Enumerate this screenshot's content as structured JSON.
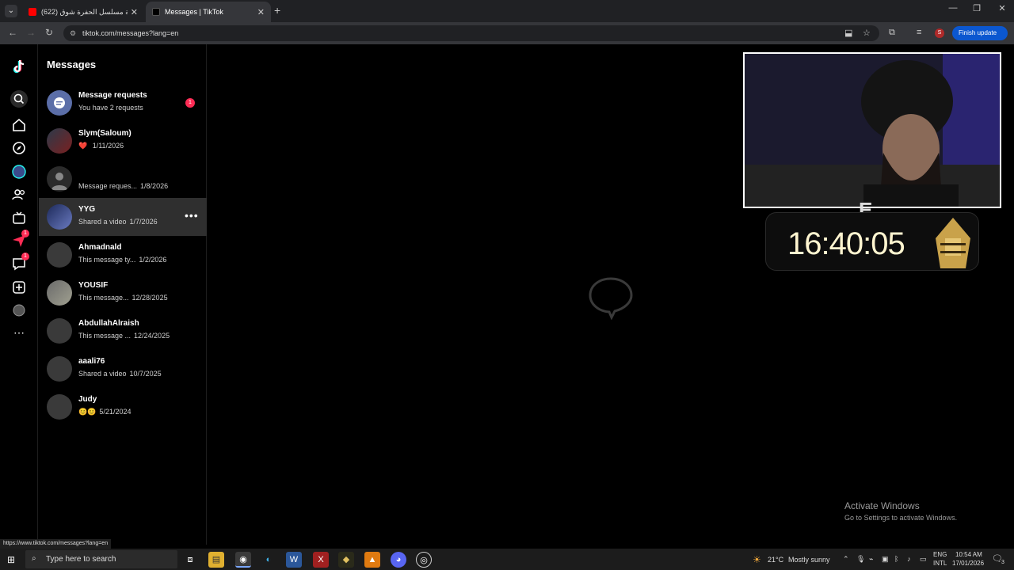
{
  "browser": {
    "tabs": [
      {
        "title": "(622) اغنية مسلسل الحفرة شوق",
        "active": false
      },
      {
        "title": "Messages | TikTok",
        "active": true
      }
    ],
    "new_tab": "+",
    "address": "tiktok.com/messages?lang=en",
    "update_button": "Finish update",
    "profile_initial": "S",
    "status_url": "https://www.tiktok.com/messages?lang=en"
  },
  "rail": {
    "badges": {
      "activity": "1",
      "inbox": "1"
    }
  },
  "messages": {
    "title": "Messages",
    "requests": {
      "name": "Message requests",
      "sub": "You have 2 requests",
      "badge": "1"
    },
    "conversations": [
      {
        "name": "Slym(Saloum)",
        "preview": "❤️ ",
        "date": "1/11/2026"
      },
      {
        "name": "",
        "preview": "Message reques...",
        "date": "1/8/2026"
      },
      {
        "name": "YYG",
        "preview": "Shared a video",
        "date": "1/7/2026"
      },
      {
        "name": "Ahmadnald",
        "preview": "This message ty...",
        "date": "1/2/2026"
      },
      {
        "name": "YOUSIF",
        "preview": "This message...",
        "date": "12/28/2025"
      },
      {
        "name": "AbdullahAlraish",
        "preview": "This message ...",
        "date": "12/24/2025"
      },
      {
        "name": "aaali76",
        "preview": "Shared a video",
        "date": "10/7/2025"
      },
      {
        "name": "Judy",
        "preview": "😊😊",
        "date": "5/21/2024"
      }
    ]
  },
  "overlay": {
    "clock": "16:40:05",
    "logo_letter": "E"
  },
  "windows": {
    "activate_title": "Activate Windows",
    "activate_sub": "Go to Settings to activate Windows.",
    "taskbar": {
      "search_placeholder": "Type here to search",
      "weather_temp": "21°C",
      "weather_text": "Mostly sunny",
      "lang_line1": "ENG",
      "lang_line2": "INTL",
      "time": "10:54 AM",
      "date": "17/01/2026",
      "notif_count": "3"
    }
  },
  "colors": {
    "accent": "#fe2c55",
    "panel_bg": "#000000",
    "hover_row": "#2f2f2f",
    "browser_update": "#0b57d0"
  }
}
